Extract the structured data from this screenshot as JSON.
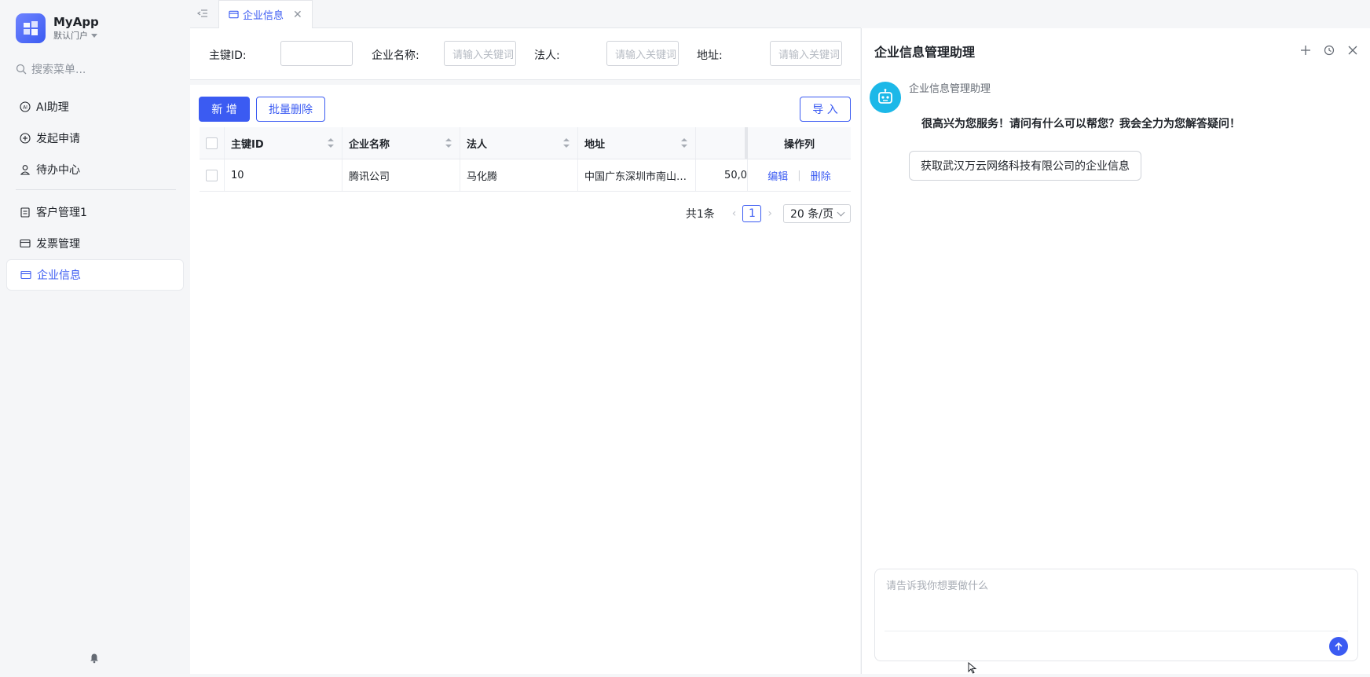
{
  "app": {
    "name": "MyApp",
    "portal": "默认门户"
  },
  "sidebar": {
    "search_placeholder": "搜索菜单...",
    "items": [
      {
        "label": "AI助理",
        "icon": "ai-icon"
      },
      {
        "label": "发起申请",
        "icon": "plus-circle-icon"
      },
      {
        "label": "待办中心",
        "icon": "user-icon"
      },
      {
        "label": "客户管理1",
        "icon": "clipboard-icon"
      },
      {
        "label": "发票管理",
        "icon": "card-icon"
      },
      {
        "label": "企业信息",
        "icon": "card-icon",
        "active": true
      }
    ]
  },
  "tabs": [
    {
      "label": "企业信息",
      "active": true
    }
  ],
  "search_form": {
    "id_label": "主键ID:",
    "name_label": "企业名称:",
    "name_placeholder": "请输入关键词",
    "legal_label": "法人:",
    "legal_placeholder": "请输入关键词",
    "address_label": "地址:",
    "address_placeholder": "请输入关键词"
  },
  "toolbar": {
    "add": "新 增",
    "batch_delete": "批量删除",
    "import": "导 入"
  },
  "table": {
    "columns": [
      "主键ID",
      "企业名称",
      "法人",
      "地址",
      "",
      "操作列"
    ],
    "rows": [
      {
        "id": "10",
        "name": "腾讯公司",
        "legal": "马化腾",
        "address": "中国广东深圳市南山…",
        "extra": "50,0",
        "edit": "编辑",
        "delete": "删除"
      }
    ]
  },
  "pagination": {
    "total": "共1条",
    "current": "1",
    "page_size": "20 条/页"
  },
  "assistant": {
    "title": "企业信息管理助理",
    "bot_name": "企业信息管理助理",
    "greeting": "很高兴为您服务！请问有什么可以帮您？我会全力为您解答疑问！",
    "suggestion": "获取武汉万云网络科技有限公司的企业信息",
    "input_placeholder": "请告诉我你想要做什么"
  },
  "colors": {
    "primary": "#3b5bf2",
    "bot_avatar": "#1cb8e8"
  }
}
